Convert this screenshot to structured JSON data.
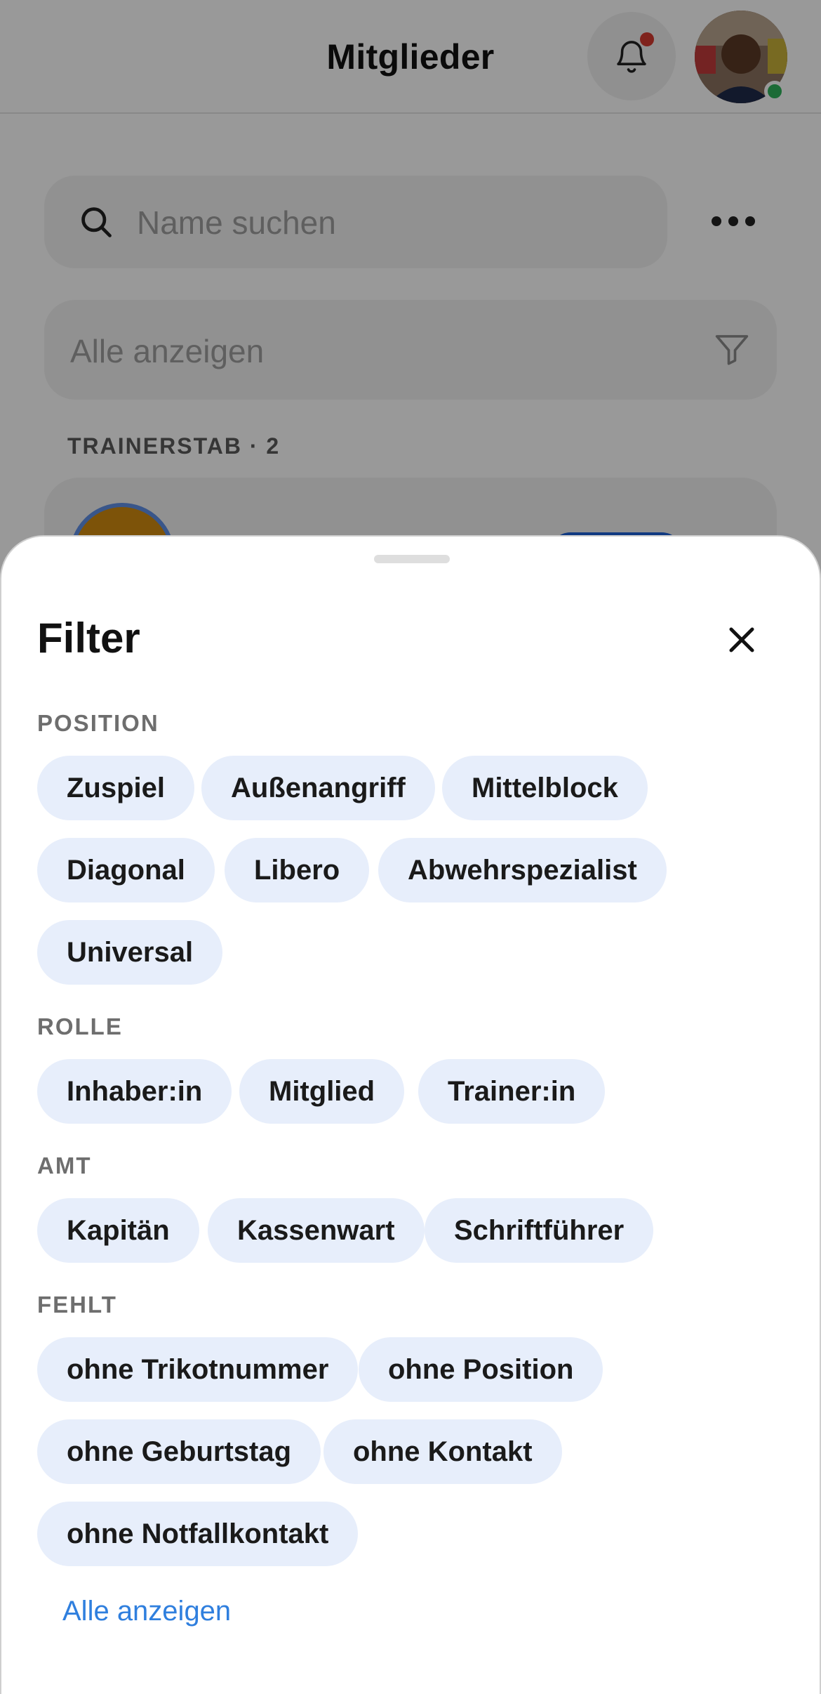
{
  "header": {
    "title": "Mitglieder",
    "bell_icon": "bell-icon",
    "notification_dot_color": "#d43a2f",
    "online_status_color": "#2fb25b"
  },
  "search": {
    "placeholder": "Name suchen",
    "icon": "search-icon"
  },
  "more_menu_icon": "more-horizontal-icon",
  "filter_field": {
    "value": "Alle anzeigen",
    "icon": "funnel-icon"
  },
  "list": {
    "section_label": "TRAINERSTAB · 2"
  },
  "sheet": {
    "title": "Filter",
    "close_icon": "close-icon",
    "groups": {
      "position": {
        "label": "POSITION",
        "chips": [
          "Zuspiel",
          "Außenangriff",
          "Mittelblock",
          "Diagonal",
          "Libero",
          "Abwehrspezialist",
          "Universal"
        ]
      },
      "rolle": {
        "label": "ROLLE",
        "chips": [
          "Inhaber:in",
          "Mitglied",
          "Trainer:in"
        ]
      },
      "amt": {
        "label": "AMT",
        "chips": [
          "Kapitän",
          "Kassenwart",
          "Schriftführer"
        ]
      },
      "fehlt": {
        "label": "FEHLT",
        "chips": [
          "ohne Trikotnummer",
          "ohne Position",
          "ohne Geburtstag",
          "ohne Kontakt",
          "ohne Notfallkontakt"
        ]
      }
    },
    "show_all_link": "Alle anzeigen",
    "colors": {
      "chip_bg": "#e7eefb",
      "link": "#2f7fde"
    }
  }
}
